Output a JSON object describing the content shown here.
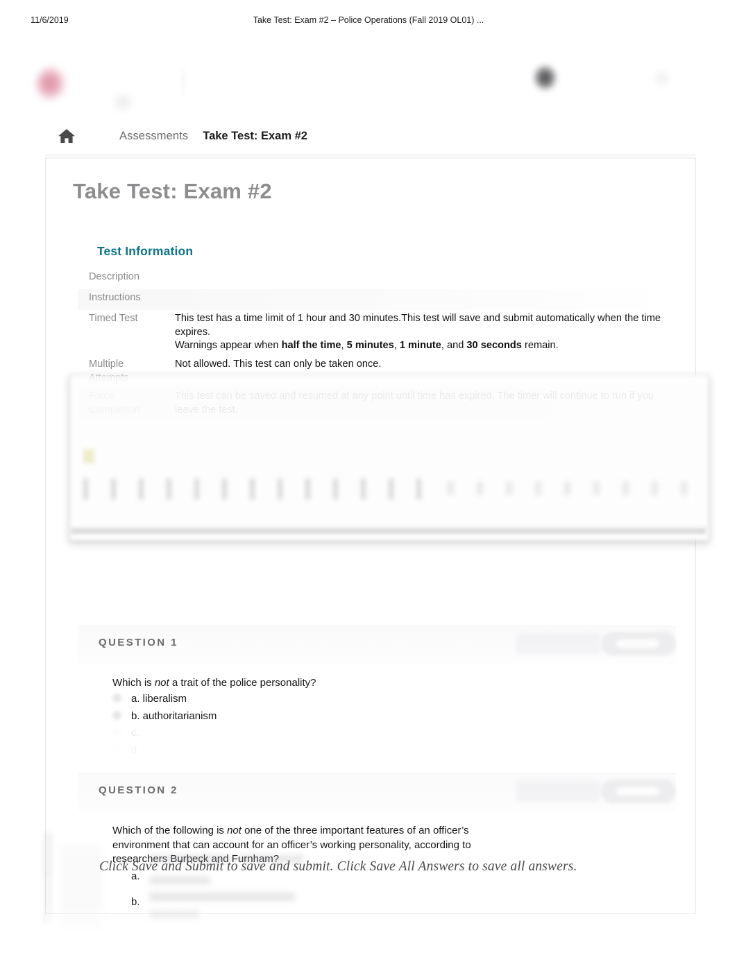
{
  "print_header": {
    "date": "11/6/2019",
    "title": "Take Test: Exam #2 – Police Operations (Fall 2019 OL01) ..."
  },
  "breadcrumb": {
    "home_icon": "home-icon",
    "parent": "Assessments",
    "current": "Take Test: Exam #2"
  },
  "page": {
    "title": "Take Test: Exam #2"
  },
  "test_information": {
    "heading": "Test Information",
    "rows": [
      {
        "label": "Description",
        "value": ""
      },
      {
        "label": "Instructions",
        "value": ""
      },
      {
        "label": "Timed Test",
        "value_line1": "This test has a time limit of 1 hour and 30 minutes.This test will save and submit automatically when the time expires.",
        "value_line2_pre": "Warnings appear when ",
        "b1": "half the time",
        "sep1": ", ",
        "b2": "5 minutes",
        "sep2": ", ",
        "b3": "1 minute",
        "sep3": ", and ",
        "b4": "30 seconds",
        "value_line2_post": " remain."
      },
      {
        "label": "Multiple Attempts",
        "value": "Not allowed. This test can only be taken once."
      },
      {
        "label": "Force Completion",
        "value": "This test can be saved and resumed at any point until time has expired. The timer will continue to run if you leave the test."
      }
    ]
  },
  "questions": [
    {
      "label": "QUESTION 1",
      "text_pre": "Which is ",
      "text_em": "not",
      "text_post": " a trait of the police personality?",
      "options": [
        {
          "text": "a. liberalism"
        },
        {
          "text": "b. authoritarianism"
        },
        {
          "text": "c."
        },
        {
          "text": "d."
        }
      ]
    },
    {
      "label": "QUESTION 2",
      "text_pre": "Which of the following is ",
      "text_em": "not",
      "text_post": " one of the three important features of an officer’s environment that can account for an officer’s working personality, according to researchers Burbeck and Furnham?",
      "options": [
        {
          "text": "a."
        },
        {
          "text": "b."
        }
      ]
    }
  ],
  "save_note": "Click Save and Submit to save and submit. Click Save All Answers to save all answers.",
  "colors": {
    "accent_teal": "#0c7489",
    "title_gray": "#8d8d90",
    "label_gray": "#8a8a8d",
    "question_label": "#6b6b6e",
    "logo_red": "#c43c5f"
  }
}
